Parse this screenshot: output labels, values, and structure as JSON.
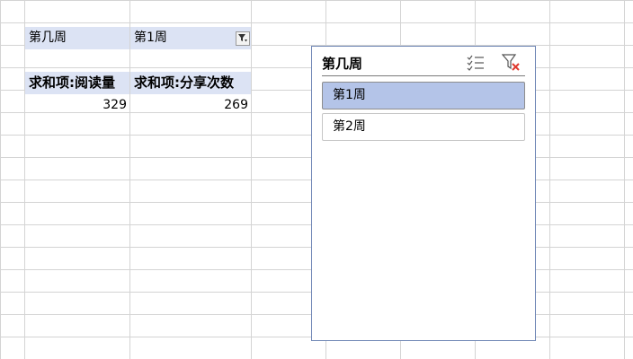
{
  "pivot": {
    "filter_label": "第几周",
    "filter_value": "第1周",
    "headers": [
      "求和项:阅读量",
      "求和项:分享次数"
    ],
    "values": [
      "329",
      "269"
    ]
  },
  "slicer": {
    "title": "第几周",
    "items": [
      {
        "label": "第1周",
        "selected": true
      },
      {
        "label": "第2周",
        "selected": false
      }
    ],
    "icons": [
      "multi-select-icon",
      "clear-filter-icon"
    ]
  },
  "colors": {
    "pivot_header_bg": "#dce3f4",
    "slicer_selected_bg": "#b4c4e8",
    "slicer_border": "#6f86b5",
    "clear_filter_red": "#e03a2f"
  }
}
